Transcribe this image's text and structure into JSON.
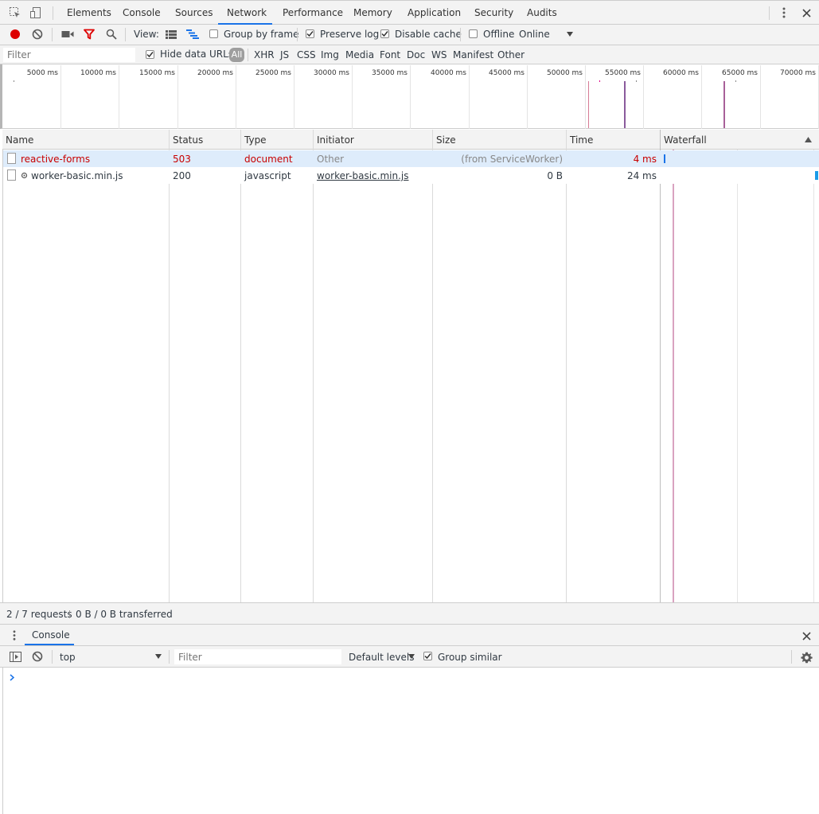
{
  "toolbar": {
    "tabs": [
      {
        "label": "Elements"
      },
      {
        "label": "Console"
      },
      {
        "label": "Sources"
      },
      {
        "label": "Network"
      },
      {
        "label": "Performance"
      },
      {
        "label": "Memory"
      },
      {
        "label": "Application"
      },
      {
        "label": "Security"
      },
      {
        "label": "Audits"
      }
    ],
    "active_tab": "Network"
  },
  "controls": {
    "view_label": "View:",
    "group_by_frame": "Group by frame",
    "preserve_log": "Preserve log",
    "disable_cache": "Disable cache",
    "offline": "Offline",
    "throttling": "Online"
  },
  "filterbar": {
    "placeholder": "Filter",
    "hide_data_urls": "Hide data URLs",
    "types": [
      "All",
      "XHR",
      "JS",
      "CSS",
      "Img",
      "Media",
      "Font",
      "Doc",
      "WS",
      "Manifest",
      "Other"
    ]
  },
  "overview": {
    "ticks": [
      "5000 ms",
      "10000 ms",
      "15000 ms",
      "20000 ms",
      "25000 ms",
      "30000 ms",
      "35000 ms",
      "40000 ms",
      "45000 ms",
      "50000 ms",
      "55000 ms",
      "60000 ms",
      "65000 ms",
      "70000 ms"
    ]
  },
  "table": {
    "columns": [
      "Name",
      "Status",
      "Type",
      "Initiator",
      "Size",
      "Time",
      "Waterfall"
    ],
    "rows": [
      {
        "name": "reactive-forms",
        "status": "503",
        "type": "document",
        "initiator": "Other",
        "size": "(from ServiceWorker)",
        "time": "4 ms"
      },
      {
        "name": "worker-basic.min.js",
        "status": "200",
        "type": "javascript",
        "initiator": "worker-basic.min.js",
        "size": "0 B",
        "time": "24 ms"
      }
    ]
  },
  "summary": {
    "requests": "2 / 7 requests",
    "transferred": "0 B / 0 B transferred"
  },
  "drawer": {
    "tab": "Console",
    "context": "top",
    "filter_placeholder": "Filter",
    "levels": "Default levels",
    "group_similar": "Group similar"
  },
  "colors": {
    "error_red": "#c80000",
    "accent_blue": "#1a73e8",
    "record_red": "#dd0000",
    "selected_row": "#deecfb"
  }
}
